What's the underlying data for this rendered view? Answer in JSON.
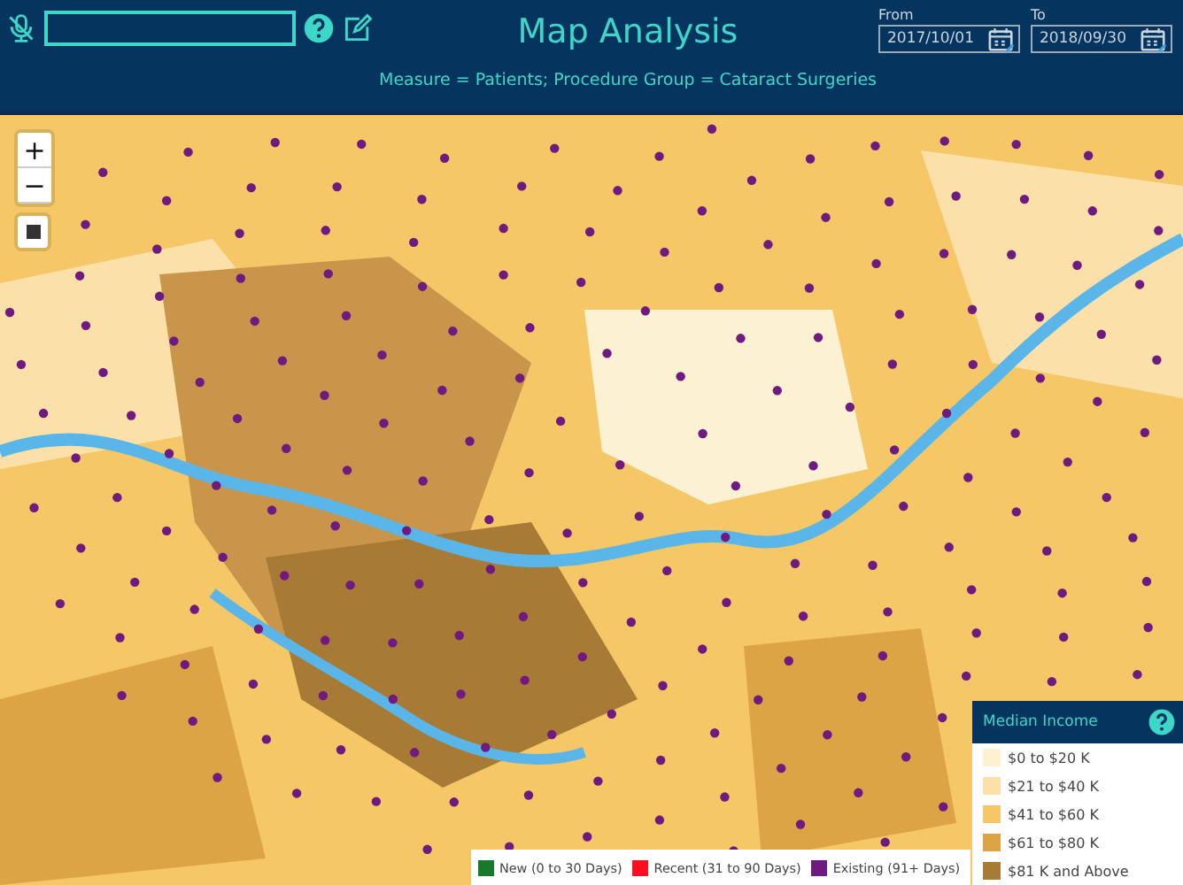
{
  "header": {
    "title": "Map Analysis",
    "subtitle": "Measure = Patients; Procedure Group = Cataract Surgeries",
    "dates": [
      {
        "label": "From",
        "value": "2017/10/01"
      },
      {
        "label": "To",
        "value": "2018/09/30"
      }
    ]
  },
  "map_controls": [
    {
      "label": "+"
    },
    {
      "label": "−"
    }
  ],
  "income_legend": {
    "title": "Median Income",
    "items": [
      {
        "label": "$0 to $20 K",
        "color": "#fdf1d4"
      },
      {
        "label": "$21 to $40 K",
        "color": "#fbe1a9"
      },
      {
        "label": "$41 to $60 K",
        "color": "#f6c766"
      },
      {
        "label": "$61 to $80 K",
        "color": "#dca445"
      },
      {
        "label": "$81 K and Above",
        "color": "#a77b35"
      }
    ]
  },
  "status_legend": [
    {
      "label": "New (0 to 30 Days)",
      "color": "#17792a"
    },
    {
      "label": "Recent (31 to 90 Days)",
      "color": "#ff0f1f"
    },
    {
      "label": "Existing (91+ Days)",
      "color": "#6e1a80"
    }
  ]
}
